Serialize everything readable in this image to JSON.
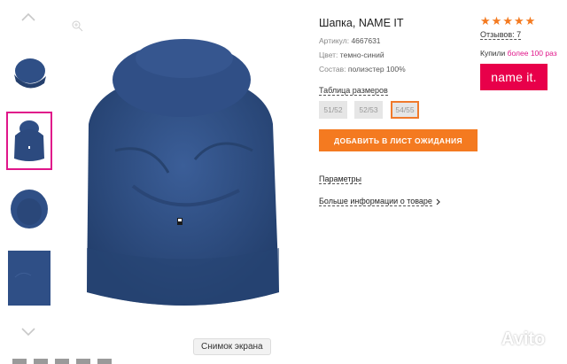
{
  "product": {
    "title": "Шапка, NAME IT",
    "article_label": "Артикул:",
    "article_value": "4667631",
    "color_label": "Цвет:",
    "color_value": "темно-синий",
    "composition_label": "Состав:",
    "composition_value": "полиэстер 100%"
  },
  "sizes": {
    "label": "Таблица размеров",
    "options": [
      "51/52",
      "52/53",
      "54/55"
    ],
    "selected": "54/55"
  },
  "actions": {
    "waitlist_label": "ДОБАВИТЬ В ЛИСТ ОЖИДАНИЯ",
    "params_label": "Параметры",
    "more_info_label": "Больше информации о товаре"
  },
  "rating": {
    "stars": 5,
    "reviews_label": "Отзывов: 7",
    "bought_prefix": "Купили",
    "bought_highlight": "более 100 раз"
  },
  "brand": {
    "logo_text": "name it."
  },
  "gallery": {
    "screenshot_label": "Снимок экрана",
    "thumbnail_count": 4,
    "selected_index": 1
  },
  "watermark": {
    "text": "Avito"
  },
  "colors": {
    "accent": "#f47a20",
    "brand_pink": "#e8004a",
    "highlight": "#e0168a",
    "hat_blue": "#2f4f86"
  }
}
